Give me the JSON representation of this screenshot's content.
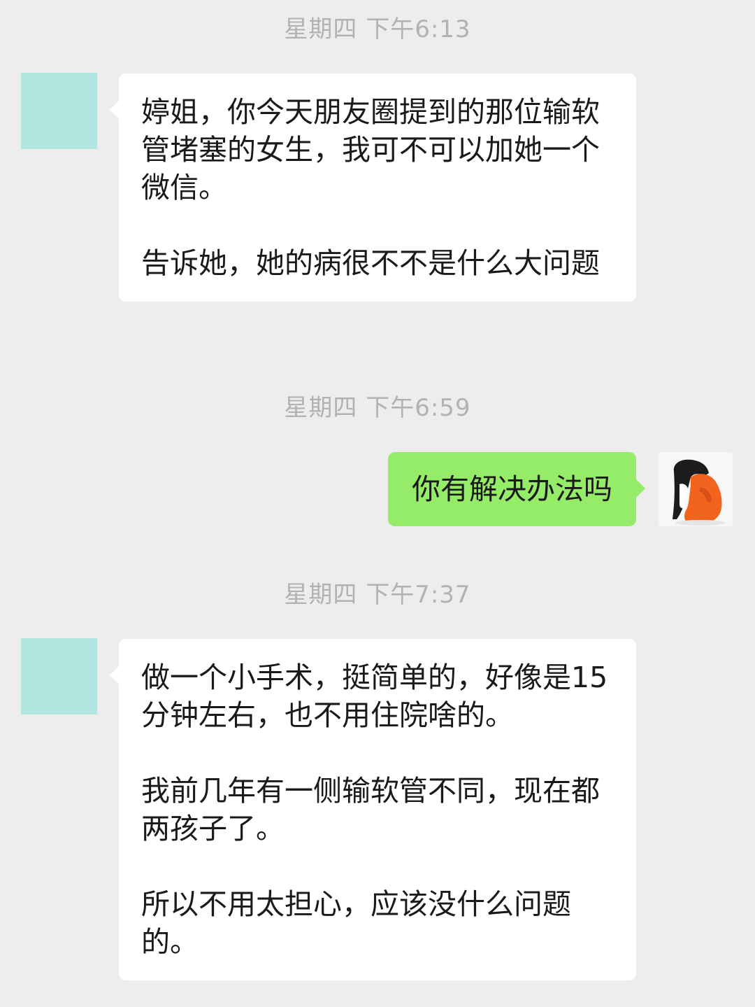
{
  "messages": [
    {
      "timestamp": "星期四 下午6:13",
      "paragraphs": [
        "婷姐，你今天朋友圈提到的那位输软管堵塞的女生，我可不可以加她一个微信。",
        "告诉她，她的病很不不是什么大问题"
      ],
      "sender": "other"
    },
    {
      "timestamp": "星期四 下午6:59",
      "text": "你有解决办法吗",
      "sender": "self"
    },
    {
      "timestamp": "星期四 下午7:37",
      "paragraphs": [
        "做一个小手术，挺简单的，好像是15分钟左右，也不用住院啥的。",
        "我前几年有一侧输软管不同，现在都两孩子了。",
        "所以不用太担心，应该没什么问题的。"
      ],
      "sender": "other"
    }
  ],
  "colors": {
    "background": "#ededed",
    "incoming_bubble": "#ffffff",
    "outgoing_bubble": "#95ec69",
    "timestamp_text": "#b2b2b2",
    "contact_avatar": "#b3e6e1"
  },
  "icons": {
    "contact_avatar": "contact-avatar",
    "self_avatar": "self-avatar-photo"
  }
}
